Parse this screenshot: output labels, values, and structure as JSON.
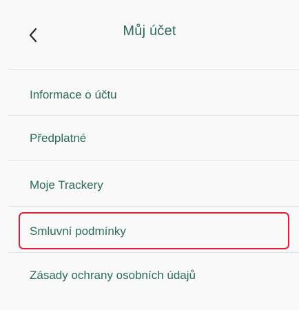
{
  "header": {
    "title": "Můj účet",
    "back_icon": "chevron-left-icon"
  },
  "menu": {
    "items": [
      {
        "label": "Informace o účtu"
      },
      {
        "label": "Předplatné"
      },
      {
        "label": "Moje Trackery"
      },
      {
        "label": "Smluvní podmínky",
        "highlighted": true
      },
      {
        "label": "Zásady ochrany osobních údajů"
      }
    ]
  },
  "colors": {
    "background": "#f8f9f8",
    "text": "#2b6b58",
    "divider": "#dfe3e1",
    "highlight": "#e41b3b"
  }
}
